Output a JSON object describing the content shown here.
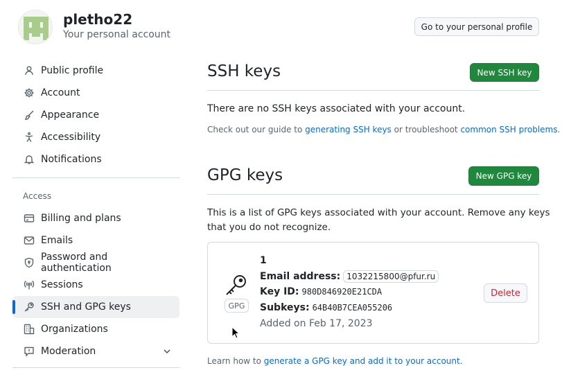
{
  "header": {
    "username": "pletho22",
    "subtitle": "Your personal account",
    "profile_button": "Go to your personal profile"
  },
  "sidebar": {
    "items": [
      {
        "label": "Public profile",
        "icon": "person-icon"
      },
      {
        "label": "Account",
        "icon": "gear-icon"
      },
      {
        "label": "Appearance",
        "icon": "paintbrush-icon"
      },
      {
        "label": "Accessibility",
        "icon": "accessibility-icon"
      },
      {
        "label": "Notifications",
        "icon": "bell-icon"
      }
    ],
    "access_heading": "Access",
    "access_items": [
      {
        "label": "Billing and plans",
        "icon": "credit-card-icon"
      },
      {
        "label": "Emails",
        "icon": "mail-icon"
      },
      {
        "label": "Password and authentication",
        "icon": "shield-lock-icon"
      },
      {
        "label": "Sessions",
        "icon": "broadcast-icon"
      },
      {
        "label": "SSH and GPG keys",
        "icon": "key-icon",
        "active": true
      },
      {
        "label": "Organizations",
        "icon": "organization-icon"
      },
      {
        "label": "Moderation",
        "icon": "report-icon"
      }
    ]
  },
  "ssh": {
    "title": "SSH keys",
    "new_button": "New SSH key",
    "empty_text": "There are no SSH keys associated with your account.",
    "guide_prefix": "Check out our guide to ",
    "guide_link": "generating SSH keys",
    "guide_middle": " or troubleshoot ",
    "guide_link2": "common SSH problems",
    "guide_suffix": "."
  },
  "gpg": {
    "title": "GPG keys",
    "new_button": "New GPG key",
    "description_line1": "This is a list of GPG keys associated with your account. Remove any keys",
    "description_line2": "that you do not recognize.",
    "key": {
      "name": "1",
      "badge": "GPG",
      "email_label": "Email address:",
      "email": "1032215800@pfur.ru",
      "key_id_label": "Key ID:",
      "key_id": "980D846920E21CDA",
      "subkeys_label": "Subkeys:",
      "subkeys": "64B40B7CEA055206",
      "added": "Added on Feb 17, 2023",
      "delete_button": "Delete"
    },
    "footer_prefix": "Learn how to ",
    "footer_link": "generate a GPG key and add it to your account",
    "footer_suffix": "."
  },
  "colors": {
    "primary_green": "#1f883d",
    "link_blue": "#0969da",
    "danger_red": "#d1242f",
    "avatar_green": "#a8cc8a"
  }
}
